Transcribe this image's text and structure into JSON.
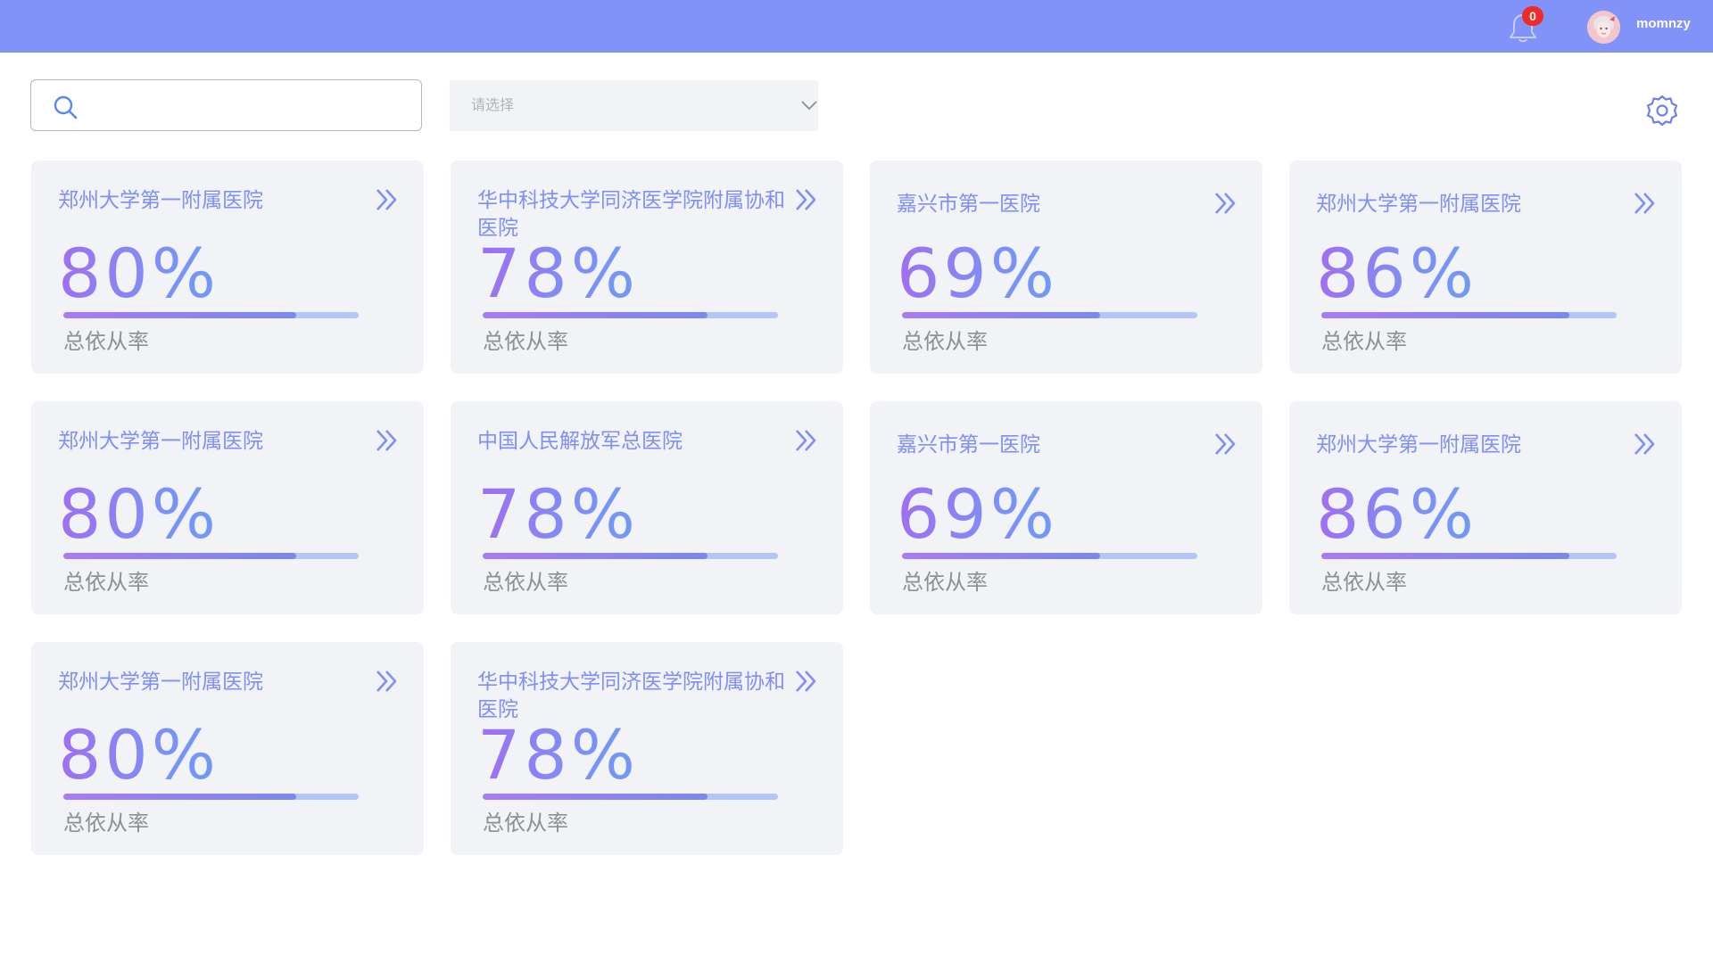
{
  "header": {
    "notification_count": "0",
    "username": "momnzy"
  },
  "search": {
    "value": "",
    "placeholder": ""
  },
  "filter": {
    "selected_label": "请选择"
  },
  "colors": {
    "topbar": "#8193f9",
    "accent": "#7f8ff6",
    "badge": "#ef2b24",
    "card_bg": "#f2f3f6",
    "bar_track": "#b3c6f6",
    "bar_fill_start": "#a87bf3",
    "bar_fill_end": "#7a88ee"
  },
  "icons": {
    "notification": "bell-icon",
    "search": "search-icon",
    "filter_dropdown": "chevron-down-icon",
    "settings": "gear-icon",
    "card_link": "double-chevron-right-icon"
  },
  "cards": [
    {
      "title": "郑州大学第一附属医院",
      "percent": "80%",
      "rate": 0.79,
      "label": "总依从率"
    },
    {
      "title": "华中科技大学同济医学院附属协和医院",
      "percent": "78%",
      "rate": 0.76,
      "label": "总依从率"
    },
    {
      "title": "嘉兴市第一医院",
      "percent": "69%",
      "rate": 0.67,
      "label": "总依从率"
    },
    {
      "title": "郑州大学第一附属医院",
      "percent": "86%",
      "rate": 0.84,
      "label": "总依从率"
    },
    {
      "title": "郑州大学第一附属医院",
      "percent": "80%",
      "rate": 0.79,
      "label": "总依从率"
    },
    {
      "title": "中国人民解放军总医院",
      "percent": "78%",
      "rate": 0.76,
      "label": "总依从率"
    },
    {
      "title": "嘉兴市第一医院",
      "percent": "69%",
      "rate": 0.67,
      "label": "总依从率"
    },
    {
      "title": "郑州大学第一附属医院",
      "percent": "86%",
      "rate": 0.84,
      "label": "总依从率"
    },
    {
      "title": "郑州大学第一附属医院",
      "percent": "80%",
      "rate": 0.79,
      "label": "总依从率"
    },
    {
      "title": "华中科技大学同济医学院附属协和医院",
      "percent": "78%",
      "rate": 0.76,
      "label": "总依从率"
    }
  ]
}
